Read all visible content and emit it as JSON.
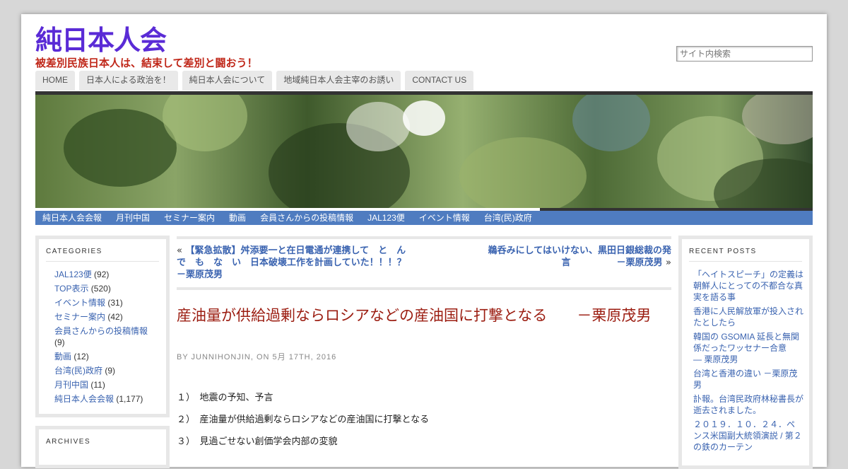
{
  "header": {
    "site_title": "純日本人会",
    "tagline": "被差別民族日本人は、結束して差別と闘おう！",
    "search_placeholder": "サイト内検索"
  },
  "top_nav": [
    {
      "label": "HOME"
    },
    {
      "label": "日本人による政治を！"
    },
    {
      "label": "純日本人会について"
    },
    {
      "label": "地域純日本人会主宰のお誘い"
    },
    {
      "label": "CONTACT US"
    }
  ],
  "category_nav": [
    {
      "label": "純日本人会会報"
    },
    {
      "label": "月刊中国"
    },
    {
      "label": "セミナー案内"
    },
    {
      "label": "動画"
    },
    {
      "label": "会員さんからの投稿情報"
    },
    {
      "label": "JAL123便"
    },
    {
      "label": "イベント情報"
    },
    {
      "label": "台湾(民)政府"
    }
  ],
  "sidebar_left": {
    "categories_title": "CATEGORIES",
    "categories": [
      {
        "name": "JAL123便",
        "count": "(92)"
      },
      {
        "name": "TOP表示",
        "count": "(520)"
      },
      {
        "name": "イベント情報",
        "count": "(31)"
      },
      {
        "name": "セミナー案内",
        "count": "(42)"
      },
      {
        "name": "会員さんからの投稿情報",
        "count": "(9)"
      },
      {
        "name": "動画",
        "count": "(12)"
      },
      {
        "name": "台湾(民)政府",
        "count": "(9)"
      },
      {
        "name": "月刊中国",
        "count": "(11)"
      },
      {
        "name": "純日本人会会報",
        "count": "(1,177)"
      }
    ],
    "archives_title": "ARCHIVES"
  },
  "post_nav": {
    "prev_arrow": "«",
    "prev_title": "【緊急拡散】舛添要一と在日電通が連携して　と　ん　で　も　な　い　日本破壊工作を計画していた！！！？　　　　－栗原茂男",
    "next_title": "鵜呑みにしてはいけない、黒田日銀総裁の発言　　　　　－栗原茂男",
    "next_arrow": "»"
  },
  "post": {
    "title": "産油量が供給過剰ならロシアなどの産油国に打撃となる　　－栗原茂男",
    "meta": "BY JUNNIHONJIN, ON 5月 17TH, 2016",
    "lines": [
      "１）　地震の予知、予言",
      "２）　産油量が供給過剰ならロシアなどの産油国に打撃となる",
      "３）　見過ごせない創価学会内部の変貌"
    ]
  },
  "sidebar_right": {
    "title": "RECENT POSTS",
    "posts": [
      "「ヘイトスピーチ」の定義は朝鮮人にとっての不都合な真実を語る事",
      "香港に人民解放軍が投入されたとしたら",
      "韓国の GSOMIA 延長と無関係だったワッセナー合意　　　　— 栗原茂男",
      "台湾と香港の違い －栗原茂男",
      "訃報。台湾民政府林秘書長が逝去されました。",
      "２０１９．１０．２４．ペンス米国副大統領演説 / 第２の鉄のカーテン"
    ]
  }
}
